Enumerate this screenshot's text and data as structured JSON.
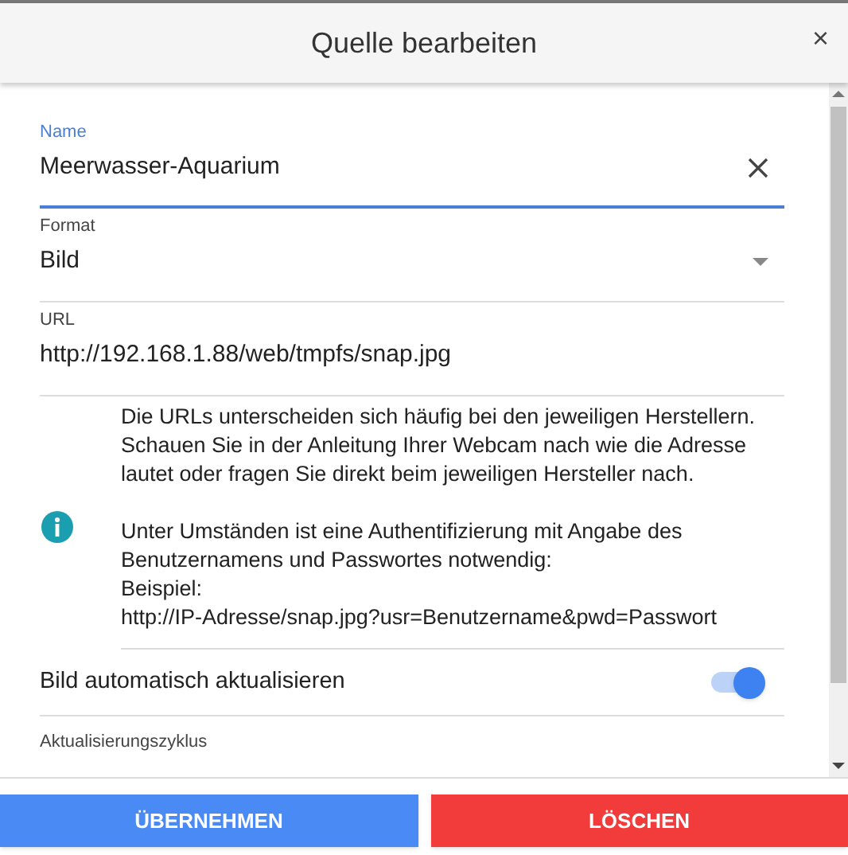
{
  "dialog": {
    "title": "Quelle bearbeiten",
    "close": "×"
  },
  "fields": [
    {
      "kind": "text",
      "label": "Name",
      "value": "Meerwasser-Aquarium",
      "focused": true
    },
    {
      "kind": "select",
      "label": "Format",
      "value": "Bild",
      "focused": false
    },
    {
      "kind": "text",
      "label": "URL",
      "value": "http://192.168.1.88/web/tmpfs/snap.jpg",
      "focused": false
    }
  ],
  "info": {
    "paragraphs": [
      "Die URLs unterscheiden sich häufig bei den jeweiligen Herstellern. Schauen Sie in der Anleitung Ihrer Webcam nach wie die Adresse lautet oder fragen Sie direkt beim jeweiligen Hersteller nach.",
      "Unter Umständen ist eine Authentifizierung mit Angabe des Benutzernamens und Passwortes notwendig:\nBeispiel:\nhttp://IP-Adresse/snap.jpg?usr=Benutzername&pwd=Passwort"
    ]
  },
  "toggle": {
    "label": "Bild automatisch aktualisieren",
    "on": true
  },
  "next_field": {
    "label": "Aktualisierungszyklus"
  },
  "buttons": [
    {
      "label": "ÜBERNEHMEN",
      "kind": "primary"
    },
    {
      "label": "LÖSCHEN",
      "kind": "danger"
    }
  ]
}
